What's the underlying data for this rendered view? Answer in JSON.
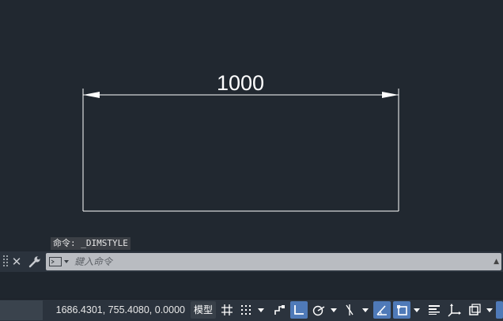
{
  "drawing": {
    "dimension_value": "1000"
  },
  "command_line": {
    "history_text": "命令: _DIMSTYLE",
    "input_placeholder": "鍵入命令",
    "input_value": ""
  },
  "status_bar": {
    "coordinates": "1686.4301, 755.4080, 0.0000",
    "model_label": "模型",
    "toggles": [
      {
        "name": "grid-icon",
        "on": false
      },
      {
        "name": "snap-icon",
        "on": false
      },
      {
        "name": "infer-constraints-icon",
        "on": false
      },
      {
        "name": "ortho-icon",
        "on": true
      },
      {
        "name": "polar-tracking-icon",
        "on": false
      },
      {
        "name": "object-snap-tracking-icon",
        "on": false
      },
      {
        "name": "dynamic-ucs-icon",
        "on": true
      },
      {
        "name": "object-snap-icon",
        "on": true
      },
      {
        "name": "lineweight-icon",
        "on": false
      },
      {
        "name": "ucs-icon",
        "on": false
      },
      {
        "name": "selection-cycling-icon",
        "on": false
      }
    ]
  },
  "colors": {
    "canvas": "#212830",
    "status_bar": "#2b333d",
    "toggle_on": "#4f7ab8",
    "line": "#ffffff"
  }
}
